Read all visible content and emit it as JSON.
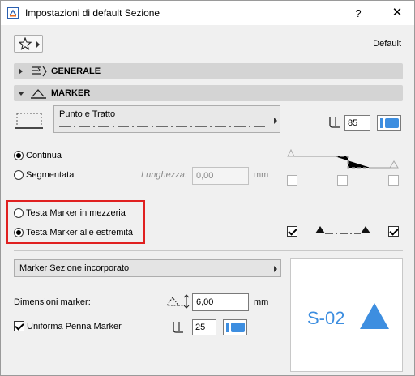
{
  "window": {
    "title": "Impostazioni di default Sezione",
    "help_label": "?",
    "close_label": "✕",
    "app_icon": "archicad-section-icon"
  },
  "favorites": {
    "icon": "star-icon",
    "default_label": "Default"
  },
  "sections": {
    "generale": {
      "label": "GENERALE",
      "state": "collapsed"
    },
    "marker": {
      "label": "MARKER",
      "state": "expanded"
    }
  },
  "line": {
    "type_label": "Punto e Tratto",
    "pen_value": "85",
    "pen_color": "#3d8ee0"
  },
  "options": {
    "continua_label": "Continua",
    "continua_selected": true,
    "segmentata_label": "Segmentata",
    "segmentata_selected": false,
    "lunghezza_label": "Lunghezza:",
    "lunghezza_value": "0,00",
    "lunghezza_unit": "mm"
  },
  "marker_head": {
    "mezzeria_label": "Testa Marker in mezzeria",
    "mezzeria_selected": false,
    "estremita_label": "Testa Marker alle estremità",
    "estremita_selected": true,
    "left_check": true,
    "right_check": true
  },
  "marker_panel": {
    "dropdown_label": "Marker Sezione incorporato",
    "dimensioni_label": "Dimensioni marker:",
    "dimensioni_value": "6,00",
    "dimensioni_unit": "mm",
    "uniforma_label": "Uniforma Penna Marker",
    "uniforma_checked": true,
    "pen_value": "25",
    "pen_color": "#3d8ee0"
  },
  "preview": {
    "label": "S-02",
    "color": "#3d8ee0"
  }
}
